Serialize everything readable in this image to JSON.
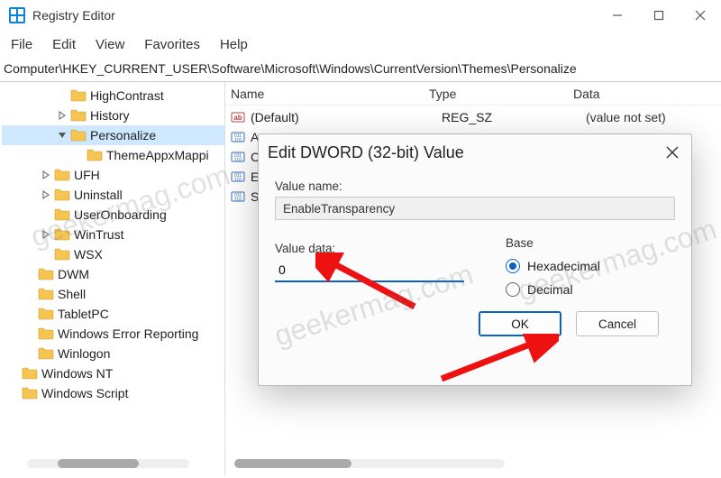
{
  "window": {
    "title": "Registry Editor"
  },
  "menu": {
    "file": "File",
    "edit": "Edit",
    "view": "View",
    "favorites": "Favorites",
    "help": "Help"
  },
  "address": "Computer\\HKEY_CURRENT_USER\\Software\\Microsoft\\Windows\\CurrentVersion\\Themes\\Personalize",
  "tree": [
    {
      "depth": 3,
      "expander": "",
      "label": "HighContrast"
    },
    {
      "depth": 3,
      "expander": ">",
      "label": "History"
    },
    {
      "depth": 3,
      "expander": "v",
      "label": "Personalize",
      "selected": true
    },
    {
      "depth": 4,
      "expander": "",
      "label": "ThemeAppxMappi"
    },
    {
      "depth": 2,
      "expander": ">",
      "label": "UFH"
    },
    {
      "depth": 2,
      "expander": ">",
      "label": "Uninstall"
    },
    {
      "depth": 2,
      "expander": "",
      "label": "UserOnboarding"
    },
    {
      "depth": 2,
      "expander": ">",
      "label": "WinTrust"
    },
    {
      "depth": 2,
      "expander": "",
      "label": "WSX"
    },
    {
      "depth": 1,
      "expander": "",
      "label": "DWM"
    },
    {
      "depth": 1,
      "expander": "",
      "label": "Shell"
    },
    {
      "depth": 1,
      "expander": "",
      "label": "TabletPC"
    },
    {
      "depth": 1,
      "expander": "",
      "label": "Windows Error Reporting"
    },
    {
      "depth": 1,
      "expander": "",
      "label": "Winlogon"
    },
    {
      "depth": 0,
      "expander": "",
      "label": "Windows NT"
    },
    {
      "depth": 0,
      "expander": "",
      "label": "Windows Script"
    }
  ],
  "list": {
    "headers": {
      "name": "Name",
      "type": "Type",
      "data": "Data"
    },
    "rows": [
      {
        "icon": "string",
        "name": "(Default)",
        "type": "REG_SZ",
        "data": "(value not set)"
      },
      {
        "icon": "dword",
        "name": "App",
        "type": "",
        "data": ""
      },
      {
        "icon": "dword",
        "name": "Colo",
        "type": "",
        "data": ""
      },
      {
        "icon": "dword",
        "name": "Enab",
        "type": "",
        "data": ""
      },
      {
        "icon": "dword",
        "name": "Syst",
        "type": "",
        "data": ""
      }
    ]
  },
  "dialog": {
    "title": "Edit DWORD (32-bit) Value",
    "value_name_label": "Value name:",
    "value_name": "EnableTransparency",
    "value_data_label": "Value data:",
    "value_data": "0",
    "base_label": "Base",
    "hex_label": "Hexadecimal",
    "dec_label": "Decimal",
    "ok": "OK",
    "cancel": "Cancel"
  },
  "watermark": "geekermag.com"
}
